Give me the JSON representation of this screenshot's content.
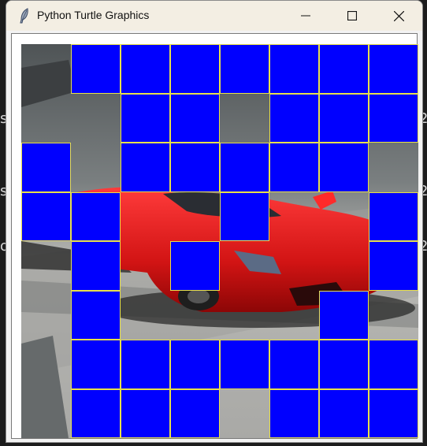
{
  "background": {
    "edge_chars": [
      "s",
      "s",
      "o"
    ],
    "edge_chars_right": [
      "2",
      "2",
      "2"
    ]
  },
  "window": {
    "title": "Python Turtle Graphics",
    "icon": "feather-icon",
    "controls": [
      "minimize-icon",
      "maximize-icon",
      "close-icon"
    ]
  },
  "grid": {
    "rows": 8,
    "cols": 8,
    "tile_color": "#0000ff",
    "line_color": "#e8e04a",
    "covered": [
      [
        0,
        1,
        1,
        1,
        1,
        1,
        1,
        1
      ],
      [
        0,
        0,
        1,
        1,
        0,
        1,
        1,
        1
      ],
      [
        1,
        0,
        1,
        1,
        1,
        1,
        1,
        0
      ],
      [
        1,
        1,
        0,
        0,
        1,
        0,
        0,
        1
      ],
      [
        0,
        1,
        0,
        1,
        0,
        0,
        0,
        1
      ],
      [
        0,
        1,
        0,
        0,
        0,
        0,
        1,
        0
      ],
      [
        0,
        1,
        1,
        1,
        1,
        1,
        1,
        1
      ],
      [
        0,
        1,
        1,
        1,
        0,
        1,
        1,
        1
      ]
    ]
  }
}
